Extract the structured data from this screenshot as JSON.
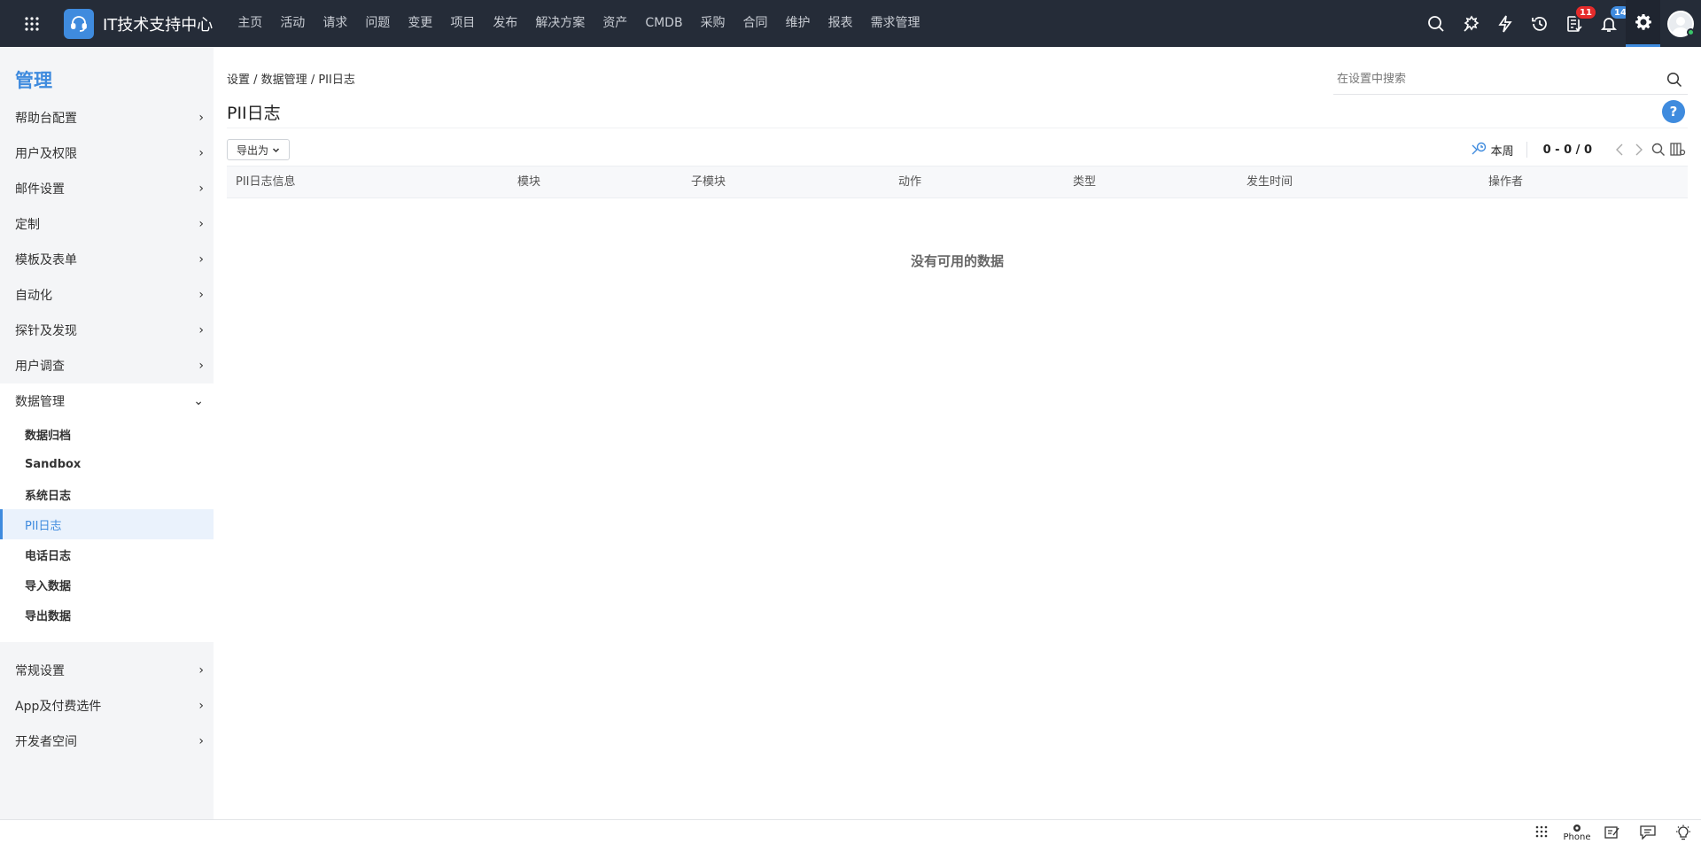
{
  "topbar": {
    "app_title": "IT技术支持中心",
    "nav": [
      "主页",
      "活动",
      "请求",
      "问题",
      "变更",
      "项目",
      "发布",
      "解决方案",
      "资产",
      "CMDB",
      "采购",
      "合同",
      "维护",
      "报表",
      "需求管理"
    ],
    "badges": {
      "tasks": "11",
      "notifications": "14"
    },
    "colors": {
      "bg": "#252c38",
      "accent": "#3f8bde",
      "badge_red": "#e52b2b"
    }
  },
  "sidebar": {
    "title": "管理",
    "items_top": [
      "帮助台配置",
      "用户及权限",
      "邮件设置",
      "定制",
      "模板及表单",
      "自动化",
      "探针及发现",
      "用户调查"
    ],
    "open_section": "数据管理",
    "sub_items": [
      "数据归档",
      "Sandbox",
      "系统日志",
      "PII日志",
      "电话日志",
      "导入数据",
      "导出数据"
    ],
    "active_sub": "PII日志",
    "items_bottom": [
      "常规设置",
      "App及付费选件",
      "开发者空间"
    ]
  },
  "main": {
    "breadcrumb": [
      "设置",
      "数据管理",
      "PII日志"
    ],
    "breadcrumb_sep": " / ",
    "title": "PII日志",
    "search_placeholder": "在设置中搜索",
    "help_label": "?",
    "export_label": "导出为",
    "period_label": "本周",
    "pager_count": "0 - 0 / 0",
    "columns": [
      "PII日志信息",
      "模块",
      "子模块",
      "动作",
      "类型",
      "发生时间",
      "操作者"
    ],
    "empty_message": "没有可用的数据"
  },
  "bottombar": {
    "phone_label": "Phone"
  }
}
